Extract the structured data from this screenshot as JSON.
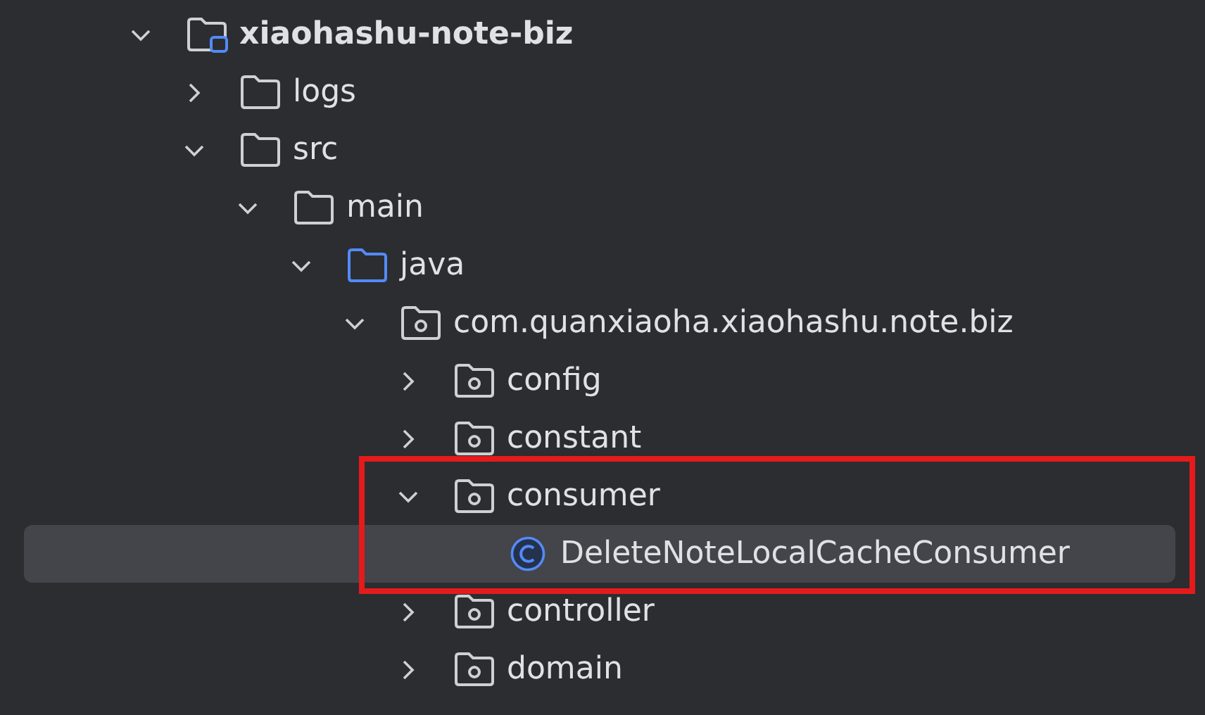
{
  "tree": [
    {
      "kind": "module",
      "label": "xiaohashu-note-biz",
      "expanded": true,
      "selected": false,
      "highlighted": false,
      "children": [
        {
          "kind": "folder",
          "label": "logs",
          "expanded": false,
          "selected": false,
          "highlighted": false
        },
        {
          "kind": "folder",
          "label": "src",
          "expanded": true,
          "selected": false,
          "highlighted": false,
          "children": [
            {
              "kind": "folder",
              "label": "main",
              "expanded": true,
              "selected": false,
              "highlighted": false,
              "children": [
                {
                  "kind": "source-folder",
                  "label": "java",
                  "expanded": true,
                  "selected": false,
                  "highlighted": false,
                  "children": [
                    {
                      "kind": "package",
                      "label": "com.quanxiaoha.xiaohashu.note.biz",
                      "expanded": true,
                      "selected": false,
                      "highlighted": false,
                      "children": [
                        {
                          "kind": "package",
                          "label": "config",
                          "expanded": false,
                          "selected": false,
                          "highlighted": false
                        },
                        {
                          "kind": "package",
                          "label": "constant",
                          "expanded": false,
                          "selected": false,
                          "highlighted": false
                        },
                        {
                          "kind": "package",
                          "label": "consumer",
                          "expanded": true,
                          "selected": false,
                          "highlighted": true,
                          "children": [
                            {
                              "kind": "class",
                              "label": "DeleteNoteLocalCacheConsumer",
                              "selected": true,
                              "highlighted": false
                            }
                          ]
                        },
                        {
                          "kind": "package",
                          "label": "controller",
                          "expanded": false,
                          "selected": false,
                          "highlighted": false
                        },
                        {
                          "kind": "package",
                          "label": "domain",
                          "expanded": false,
                          "selected": false,
                          "highlighted": false
                        }
                      ]
                    }
                  ]
                }
              ]
            }
          ]
        }
      ]
    }
  ]
}
